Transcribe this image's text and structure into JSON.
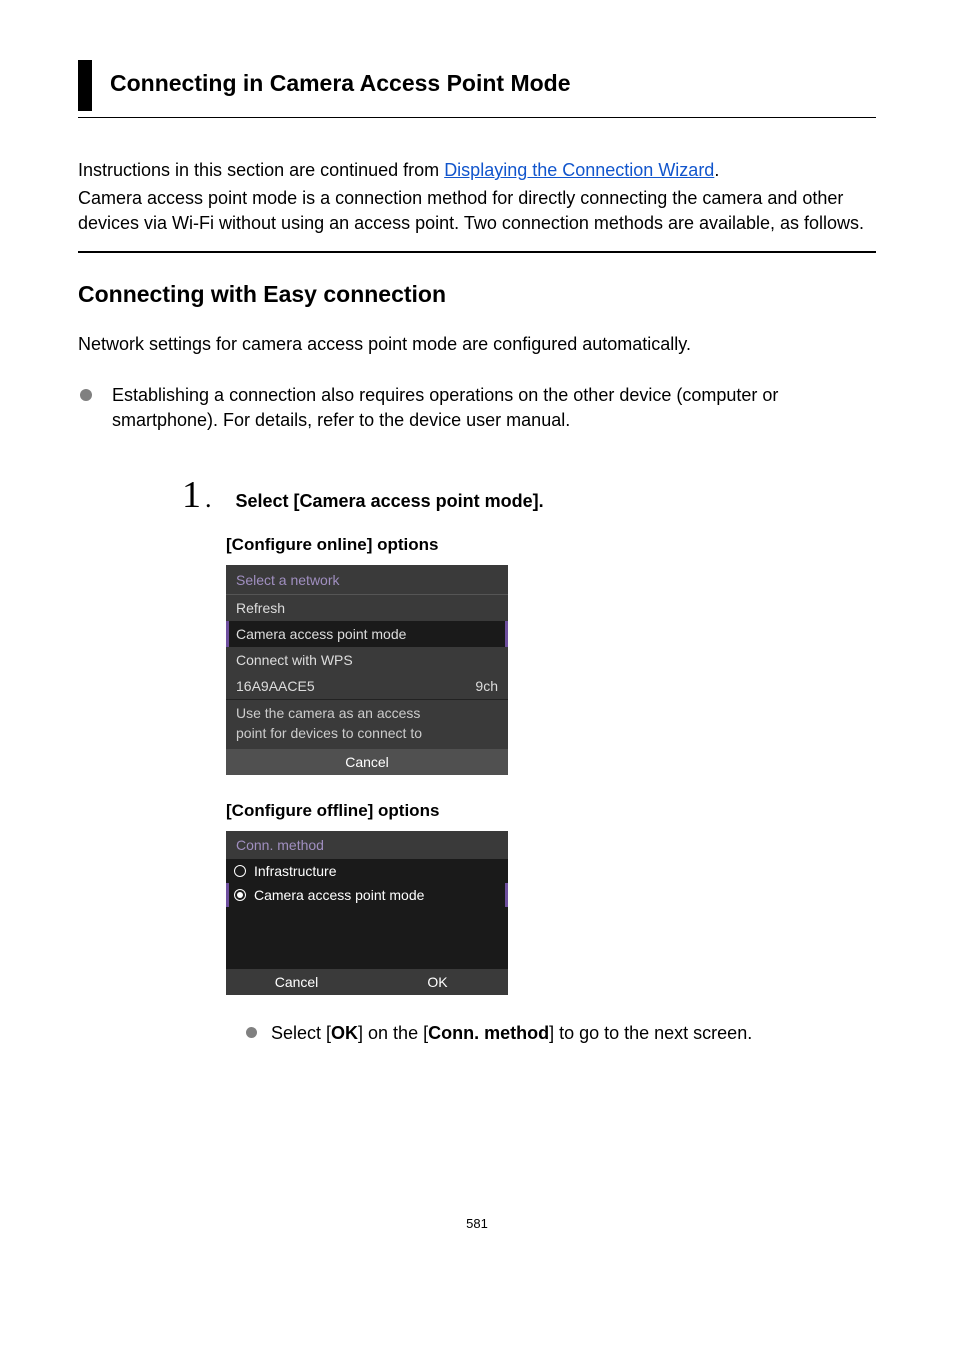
{
  "header": {
    "title": "Connecting in Camera Access Point Mode"
  },
  "intro": {
    "prefix": "Instructions in this section are continued from ",
    "link_text": "Displaying the Connection Wizard",
    "suffix": ".",
    "line2": "Camera access point mode is a connection method for directly connecting the camera and other devices via Wi-Fi without using an access point. Two connection methods are available, as follows."
  },
  "sub_heading": "Connecting with Easy connection",
  "desc1": "Network settings for camera access point mode are configured automatically.",
  "bullet1": "Establishing a connection also requires operations on the other device (computer or smartphone). For details, refer to the device user manual.",
  "step1": {
    "number": "1",
    "period": ".",
    "title": "Select [Camera access point mode].",
    "config_online_label": "[Configure online] options",
    "config_offline_label": "[Configure offline] options"
  },
  "screen1": {
    "title": "Select a network",
    "refresh": "Refresh",
    "cap_mode": "Camera access point mode",
    "wps": "Connect with WPS",
    "network_name": "16A9AACE5",
    "channel": "9ch",
    "desc1": "Use the camera as an access",
    "desc2": "point for devices to connect to",
    "cancel": "Cancel"
  },
  "screen2": {
    "title": "Conn. method",
    "opt1": "Infrastructure",
    "opt2": "Camera access point mode",
    "cancel": "Cancel",
    "ok": "OK"
  },
  "note": {
    "prefix": "Select [",
    "ok": "OK",
    "mid": "] on the [",
    "conn": "Conn. method",
    "suffix": "] to go to the next screen."
  },
  "page_number": "581"
}
